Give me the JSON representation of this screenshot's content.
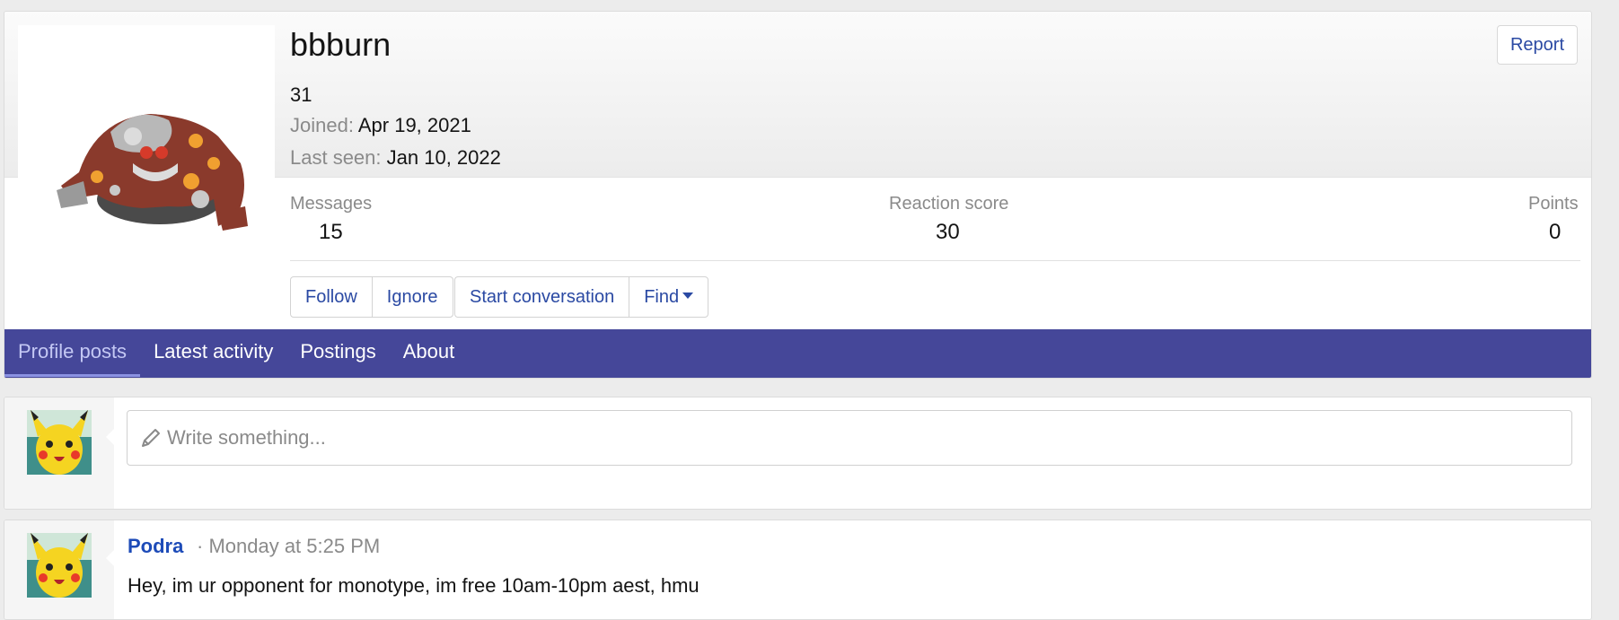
{
  "profile": {
    "username": "bbburn",
    "user_title": "31",
    "joined_label": "Joined:",
    "joined_value": "Apr 19, 2021",
    "last_seen_label": "Last seen:",
    "last_seen_value": "Jan 10, 2022",
    "report_label": "Report",
    "avatar_icon": "heatran-avatar"
  },
  "stats": {
    "messages_label": "Messages",
    "messages_value": "15",
    "reaction_label": "Reaction score",
    "reaction_value": "30",
    "points_label": "Points",
    "points_value": "0"
  },
  "actions": {
    "follow": "Follow",
    "ignore": "Ignore",
    "start_conversation": "Start conversation",
    "find": "Find"
  },
  "tabs": [
    {
      "label": "Profile posts",
      "active": true
    },
    {
      "label": "Latest activity",
      "active": false
    },
    {
      "label": "Postings",
      "active": false
    },
    {
      "label": "About",
      "active": false
    }
  ],
  "composer": {
    "placeholder": "Write something...",
    "icon": "pencil-icon",
    "avatar_icon": "pikachu-avatar"
  },
  "post": {
    "author": "Podra",
    "time": "· Monday at 5:25 PM",
    "text": "Hey, im ur opponent for monotype, im free 10am-10pm aest, hmu",
    "avatar_icon": "pikachu-avatar"
  },
  "colors": {
    "accent": "#2a49a3",
    "tabbar": "#454799",
    "tab_active": "#c4c8f4",
    "author_link": "#1d4bb8"
  }
}
